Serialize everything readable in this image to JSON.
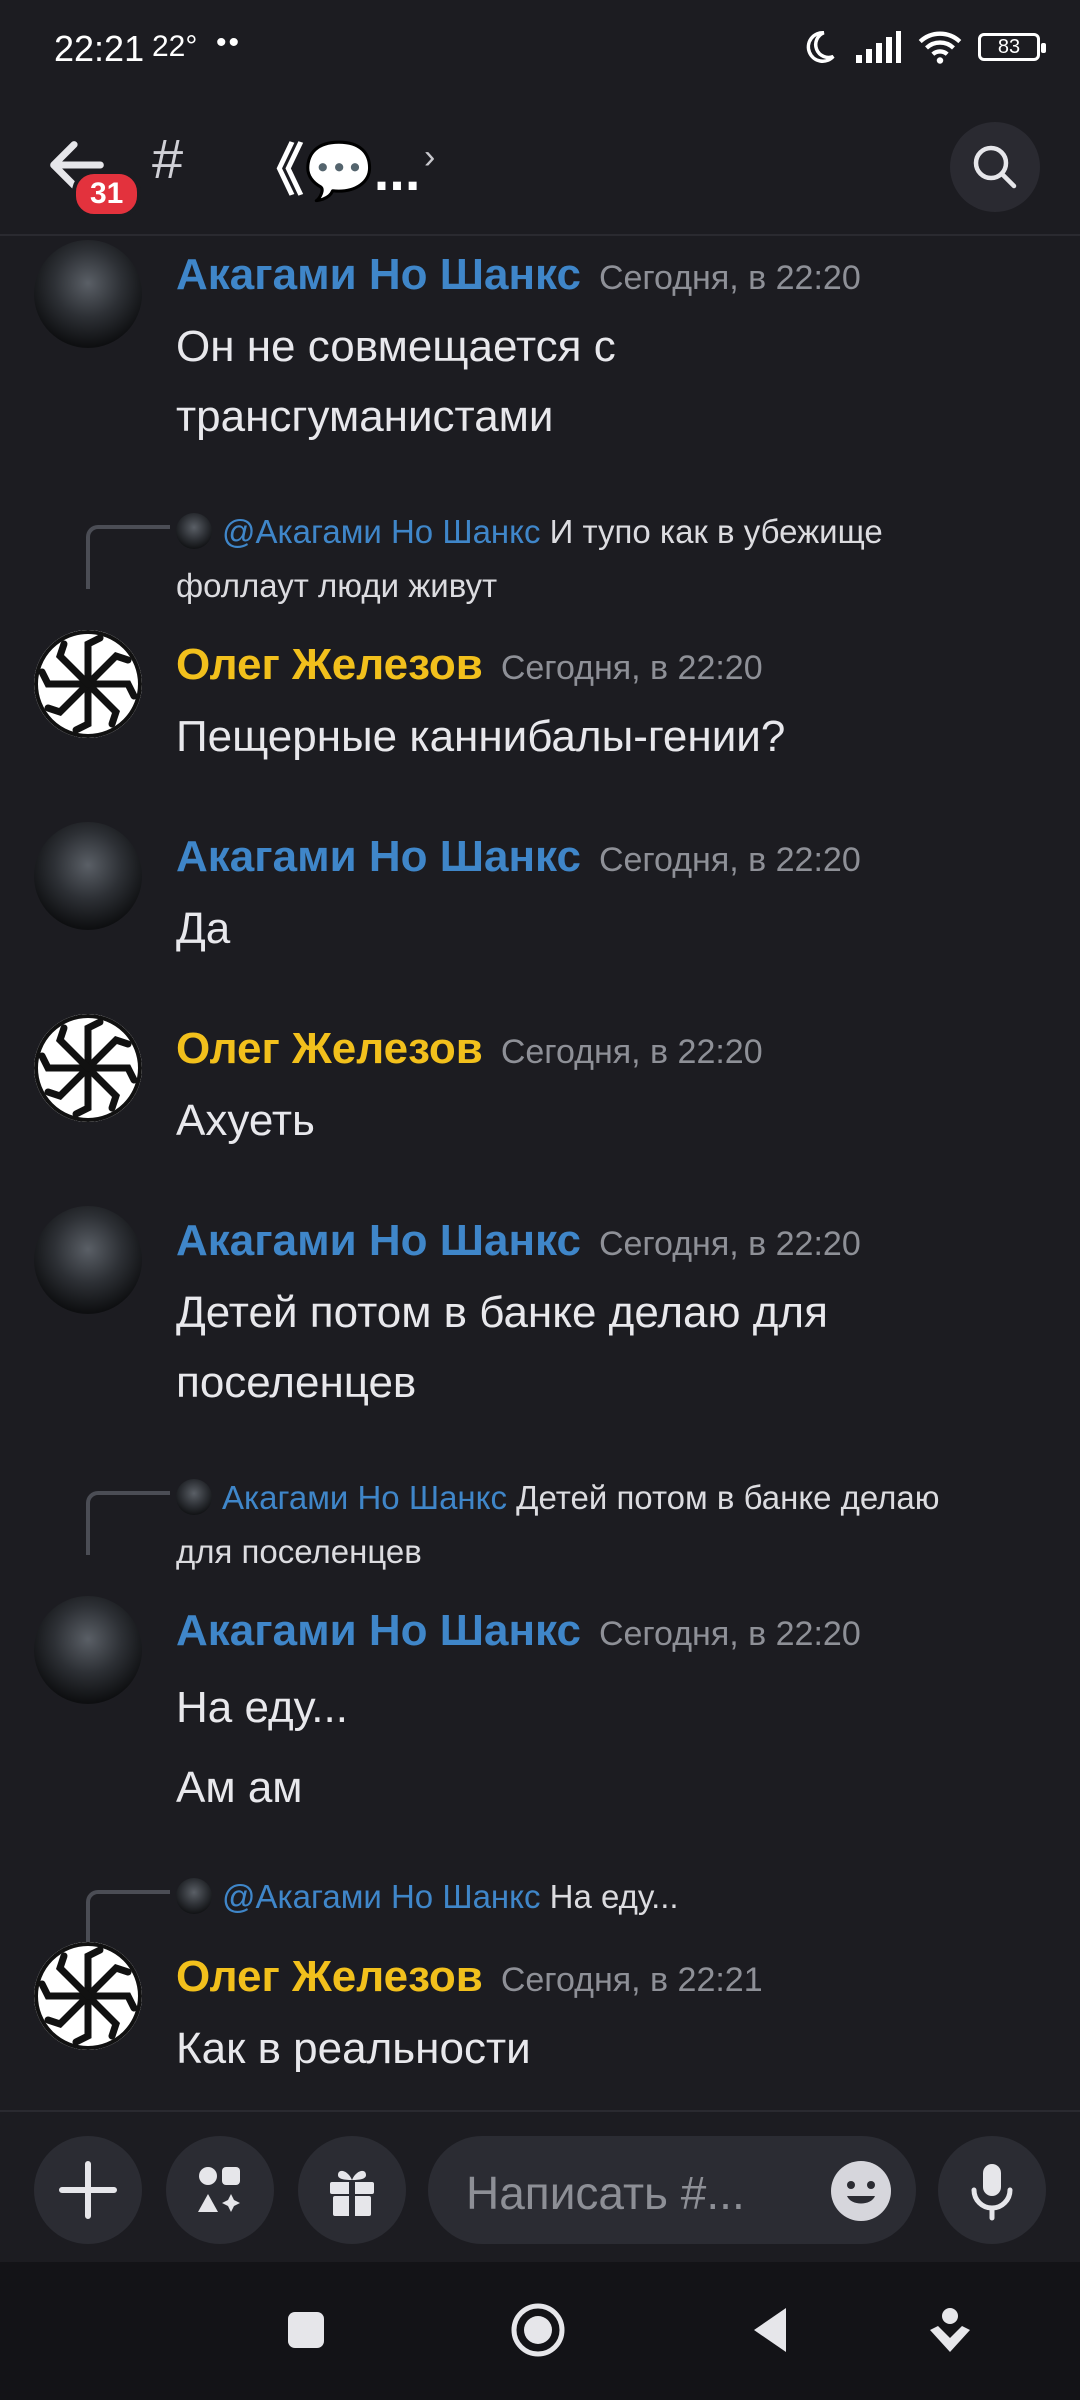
{
  "status_bar": {
    "time": "22:21",
    "temp": "22°",
    "dots": "••",
    "battery": "83"
  },
  "header": {
    "badge": "31",
    "hash": "#",
    "channel_title": "《💬...",
    "chevron": "›"
  },
  "messages": [
    {
      "author": "Акагами Но Шанкс",
      "time": "Сегодня, в 22:20",
      "lines": [
        "Он не совмещается с",
        "трансгуманистами"
      ]
    },
    {
      "reply": {
        "mention": "@Акагами Но Шанкс",
        "text": " И тупо как в убежище",
        "text2": "фоллаут люди живут"
      },
      "author": "Олег Железов",
      "time": "Сегодня, в 22:20",
      "lines": [
        "Пещерные каннибалы-гении?"
      ]
    },
    {
      "author": "Акагами Но Шанкс",
      "time": "Сегодня, в 22:20",
      "lines": [
        "Да"
      ]
    },
    {
      "author": "Олег Железов",
      "time": "Сегодня, в 22:20",
      "lines": [
        "Ахуеть"
      ]
    },
    {
      "author": "Акагами Но Шанкс",
      "time": "Сегодня, в 22:20",
      "lines": [
        "Детей потом в банке делаю для",
        "поселенцев"
      ]
    },
    {
      "reply": {
        "mention": "Акагами Но Шанкс",
        "text": " Детей потом в банке делаю",
        "text2": "для поселенцев"
      },
      "author": "Акагами Но Шанкс",
      "time": "Сегодня, в 22:20",
      "lines": [
        "На еду...",
        "Ам ам"
      ]
    },
    {
      "reply": {
        "mention": "@Акагами Но Шанкс",
        "text": " На еду..."
      },
      "author": "Олег Железов",
      "time": "Сегодня, в 22:21",
      "lines": [
        "Как в реальности"
      ]
    }
  ],
  "composer": {
    "placeholder": "Написать #..."
  },
  "icons": {
    "back": "arrow-left-icon",
    "search": "search-icon",
    "plus": "plus-icon",
    "apps": "apps-icon",
    "gift": "gift-icon",
    "emoji": "emoji-icon",
    "mic": "microphone-icon"
  },
  "colors": {
    "background": "#1c1c21",
    "author_blue": "#3f86c9",
    "author_gold": "#f2c01c",
    "badge_red": "#e3323d"
  }
}
